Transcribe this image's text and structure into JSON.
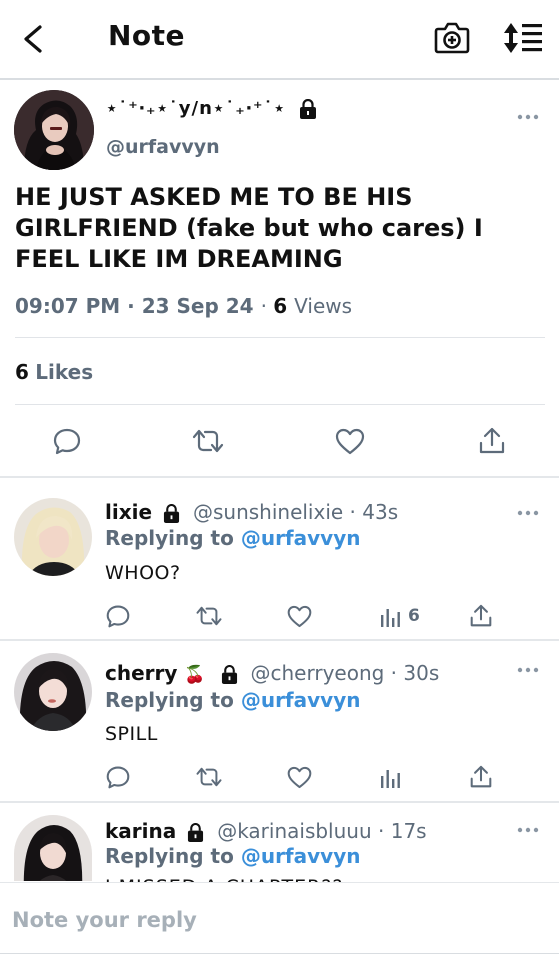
{
  "header": {
    "title": "Note"
  },
  "main_tweet": {
    "display_name": "⋆˙⁺‧₊⋆˙y/n⋆˙₊‧⁺˙⋆",
    "handle": "@urfavvyn",
    "text": "HE JUST ASKED ME TO BE HIS GIRLFRIEND (fake but who cares) I FEEL LIKE IM DREAMING",
    "time": "09:07 PM",
    "date": "23 Sep 24",
    "views_count": "6",
    "views_label": "Views",
    "likes_count": "6",
    "likes_label": "Likes"
  },
  "replies": [
    {
      "name": "lixie",
      "handle": "@sunshinelixie · 43s",
      "replying_label": "Replying to",
      "replying_to": "@urfavvyn",
      "text": "WHOO?",
      "views": "6"
    },
    {
      "name": "cherry",
      "emoji": "🍒",
      "handle": "@cherryeong · 30s",
      "replying_label": "Replying to",
      "replying_to": "@urfavvyn",
      "text": "SPILL",
      "views": ""
    },
    {
      "name": "karina",
      "handle": "@karinaisbluuu · 17s",
      "replying_label": "Replying to",
      "replying_to": "@urfavvyn",
      "text": "I MISSED A CHAPTER??"
    }
  ],
  "composer": {
    "placeholder": "Note your reply"
  },
  "icons": {
    "back": "chevron-left-icon",
    "camera": "camera-add-icon",
    "sort": "sort-icon",
    "reply": "reply-icon",
    "retweet": "retweet-icon",
    "like": "heart-icon",
    "views": "views-chart-icon",
    "share": "share-icon",
    "more": "more-icon",
    "lock": "lock-icon"
  },
  "colors": {
    "accent": "#3b8fd9",
    "secondary_text": "#5d6b7a",
    "primary_text": "#111111",
    "divider": "#e1e4e8"
  }
}
